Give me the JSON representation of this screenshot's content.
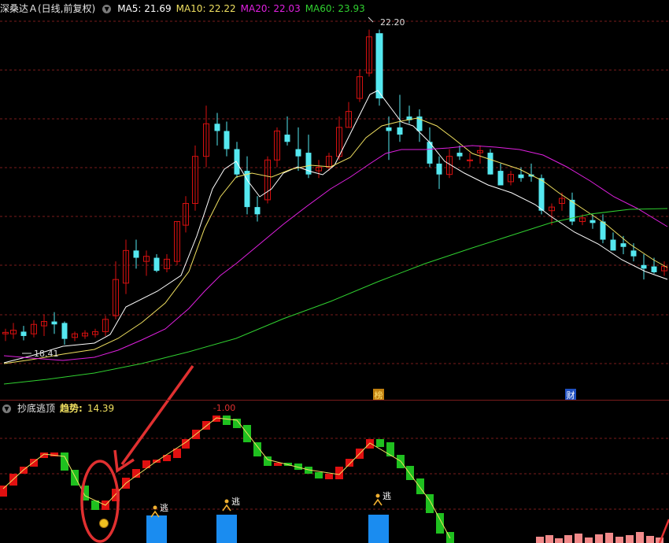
{
  "header": {
    "title": "深桑达Ａ(日线,前复权)",
    "ma5_label": "MA5: 21.69",
    "ma10_label": "MA10: 22.22",
    "ma20_label": "MA20: 22.03",
    "ma60_label": "MA60: 23.93"
  },
  "indicator": {
    "name": "抄底逃顶",
    "trend_label": "趋势:",
    "trend_value": "14.39",
    "peak_label": "-1.00",
    "escape_label": "逃"
  },
  "annotations": {
    "high_label": "22.20",
    "low_label": "18.41",
    "badge_bang": "榜",
    "badge_cai": "财"
  },
  "colors": {
    "up": "#d81010",
    "down": "#55e8f0",
    "ma5": "#ffffff",
    "ma10": "#f0e060",
    "ma20": "#e020e0",
    "ma60": "#30d030",
    "grid": "#7a1c1c",
    "annotation": "#e03030"
  }
}
